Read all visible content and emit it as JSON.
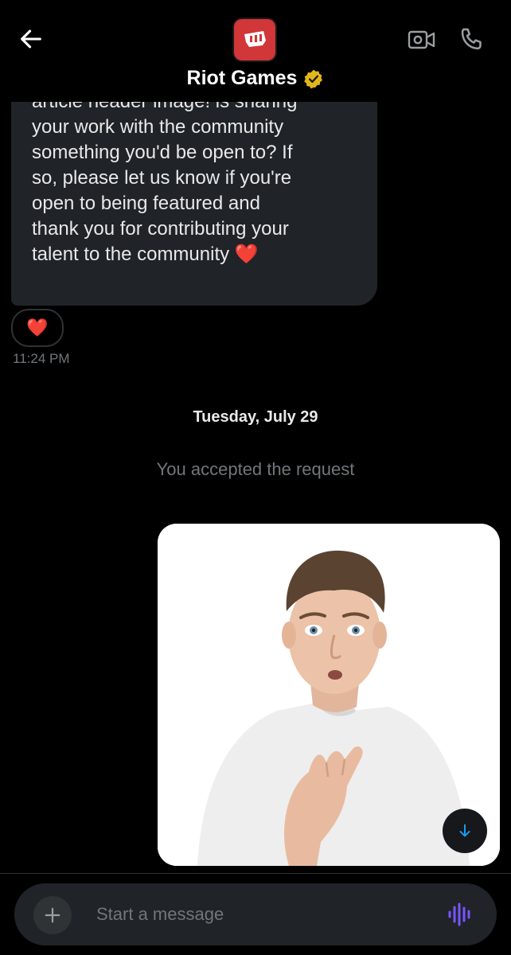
{
  "header": {
    "contact_name": "Riot Games",
    "icons": [
      "back-arrow-icon",
      "video-call-icon",
      "phone-icon",
      "verified-badge-icon"
    ]
  },
  "conversation": {
    "received_message": "article header image! is sharing\nyour work with the community\nsomething you'd be open to? If\nso, please let us know if you're\nopen to being featured and\nthank you for contributing your\ntalent to the community",
    "received_emoji": "❤️",
    "reaction": "❤️",
    "timestamp": "11:24 PM",
    "date_divider": "Tuesday, July 29",
    "system_message": "You accepted the request"
  },
  "compose": {
    "placeholder": "Start a message"
  },
  "colors": {
    "background": "#000000",
    "bubble": "#202327",
    "accent_blue": "#1d9bf0",
    "voice_purple": "#7856ff",
    "riot_red": "#d13639"
  }
}
